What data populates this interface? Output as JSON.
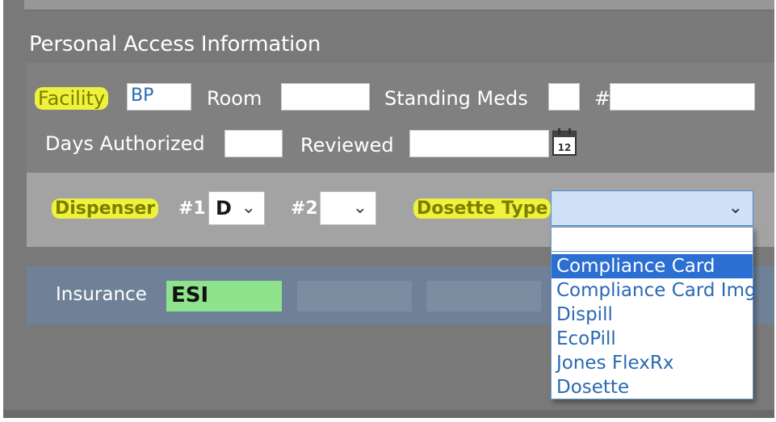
{
  "section": {
    "title": "Personal Access Information"
  },
  "facility_row": {
    "facility_label": "Facility",
    "facility_value": "BP",
    "room_label": "Room",
    "room_value": "",
    "standing_meds_label": "Standing Meds",
    "standing_meds_value": "",
    "number_label": "#",
    "number_value": ""
  },
  "auth_row": {
    "days_authorized_label": "Days Authorized",
    "days_authorized_value": "",
    "reviewed_label": "Reviewed",
    "reviewed_value": "",
    "calendar_icon_text": "12",
    "calendar_icon": "calendar-icon"
  },
  "dispenser_row": {
    "dispenser_label": "Dispenser",
    "slot1_label": "#1",
    "slot1_value": "D",
    "slot2_label": "#2",
    "slot2_value": "",
    "dosette_label": "Dosette Type",
    "dosette_value": ""
  },
  "dosette_options": [
    {
      "label": "",
      "selected": false
    },
    {
      "label": "Compliance Card",
      "selected": true
    },
    {
      "label": "Compliance Card Img",
      "selected": false
    },
    {
      "label": "Dispill",
      "selected": false
    },
    {
      "label": "EcoPill",
      "selected": false
    },
    {
      "label": "Jones FlexRx",
      "selected": false
    },
    {
      "label": "Dosette",
      "selected": false
    }
  ],
  "insurance": {
    "label": "Insurance",
    "primary": "ESI"
  },
  "colors": {
    "highlight": "#eef23c",
    "insurance_primary": "#8ee38c",
    "selected_option": "#2a6fd1",
    "link_text": "#2a69b3"
  }
}
